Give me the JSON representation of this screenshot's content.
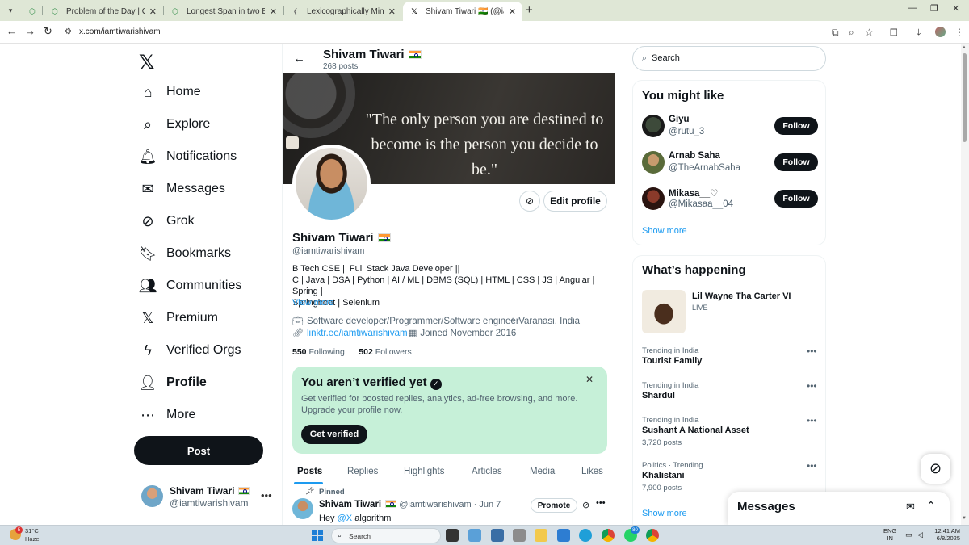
{
  "browser": {
    "tabs": [
      {
        "title": "Problem of the Day | GeeksforG",
        "active": false
      },
      {
        "title": "Longest Span in two Binary Arr",
        "active": false
      },
      {
        "title": "Lexicographically Minimum Stri",
        "active": false
      },
      {
        "title": "Shivam Tiwari 🇮🇳 (@iamtiwari",
        "active": true
      }
    ],
    "url": "x.com/iamtiwarishivam"
  },
  "sidebar": {
    "items": [
      {
        "label": "Home",
        "icon": "home-icon"
      },
      {
        "label": "Explore",
        "icon": "search-icon"
      },
      {
        "label": "Notifications",
        "icon": "bell-icon"
      },
      {
        "label": "Messages",
        "icon": "mail-icon"
      },
      {
        "label": "Grok",
        "icon": "grok-icon"
      },
      {
        "label": "Bookmarks",
        "icon": "bookmark-icon"
      },
      {
        "label": "Communities",
        "icon": "people-icon"
      },
      {
        "label": "Premium",
        "icon": "x-logo-icon"
      },
      {
        "label": "Verified Orgs",
        "icon": "lightning-icon"
      },
      {
        "label": "Profile",
        "icon": "person-icon"
      },
      {
        "label": "More",
        "icon": "more-circle-icon"
      }
    ],
    "post_label": "Post",
    "account": {
      "name": "Shivam Tiwari",
      "handle": "@iamtiwarishivam"
    }
  },
  "profile": {
    "header_name": "Shivam Tiwari",
    "posts_count": "268 posts",
    "banner_quote_line1": "\"The only person you are destined to",
    "banner_quote_line2": "become is the person you decide to be.\"",
    "edit_label": "Edit profile",
    "name": "Shivam Tiwari",
    "handle": "@iamtiwarishivam",
    "bio_line1": "B Tech CSE || Full Stack Java Developer ||",
    "bio_line2": "C | Java | DSA | Python | AI / ML | DBMS (SQL) | HTML | CSS | JS | Angular | Spring |",
    "bio_line3": "Springboot | Selenium",
    "view_more": "View more",
    "job": "Software developer/Programmer/Software engineer",
    "location": "Varanasi, India",
    "link": "linktr.ee/iamtiwarishivam",
    "joined": "Joined November 2016",
    "following_count": "550",
    "following_label": "Following",
    "followers_count": "502",
    "followers_label": "Followers"
  },
  "verify": {
    "title": "You aren’t verified yet",
    "text": "Get verified for boosted replies, analytics, ad-free browsing, and more. Upgrade your profile now.",
    "button": "Get verified"
  },
  "profile_tabs": [
    "Posts",
    "Replies",
    "Highlights",
    "Articles",
    "Media",
    "Likes"
  ],
  "pinned_post": {
    "pinned_label": "Pinned",
    "name": "Shivam Tiwari",
    "handle": "@iamtiwarishivam",
    "date": "· Jun 7",
    "promote": "Promote",
    "text_prefix": "Hey",
    "mention": "@X",
    "text_suffix": "algorithm"
  },
  "right": {
    "search_placeholder": "Search",
    "you_might_like_title": "You might like",
    "suggestions": [
      {
        "name": "Giyu",
        "handle": "@rutu_3",
        "follow": "Follow"
      },
      {
        "name": "Arnab Saha",
        "handle": "@TheArnabSaha",
        "follow": "Follow"
      },
      {
        "name": "Mikasa__♡",
        "handle": "@Mikasaa__04",
        "follow": "Follow"
      }
    ],
    "show_more": "Show more",
    "happening_title": "What’s happening",
    "event": {
      "title": "Lil Wayne Tha Carter VI",
      "status": "LIVE"
    },
    "trends": [
      {
        "context": "Trending in India",
        "title": "Tourist Family",
        "count": ""
      },
      {
        "context": "Trending in India",
        "title": "Shardul",
        "count": ""
      },
      {
        "context": "Trending in India",
        "title": "Sushant A National Asset",
        "count": "3,720 posts"
      },
      {
        "context": "Politics · Trending",
        "title": "Khalistani",
        "count": "7,900 posts"
      }
    ],
    "show_more_2": "Show more"
  },
  "messages_drawer": {
    "title": "Messages"
  },
  "taskbar": {
    "temp": "31°C",
    "weather": "Haze",
    "weather_badge": "5",
    "search_placeholder": "Search",
    "badge_whatsapp": "80",
    "lang1": "ENG",
    "lang2": "IN",
    "time": "12:41 AM",
    "date": "6/8/2025"
  },
  "colors": {
    "accent": "#1d9bf0",
    "verify_bg": "#c6f0d8",
    "text": "#0f1419",
    "muted": "#536471"
  }
}
